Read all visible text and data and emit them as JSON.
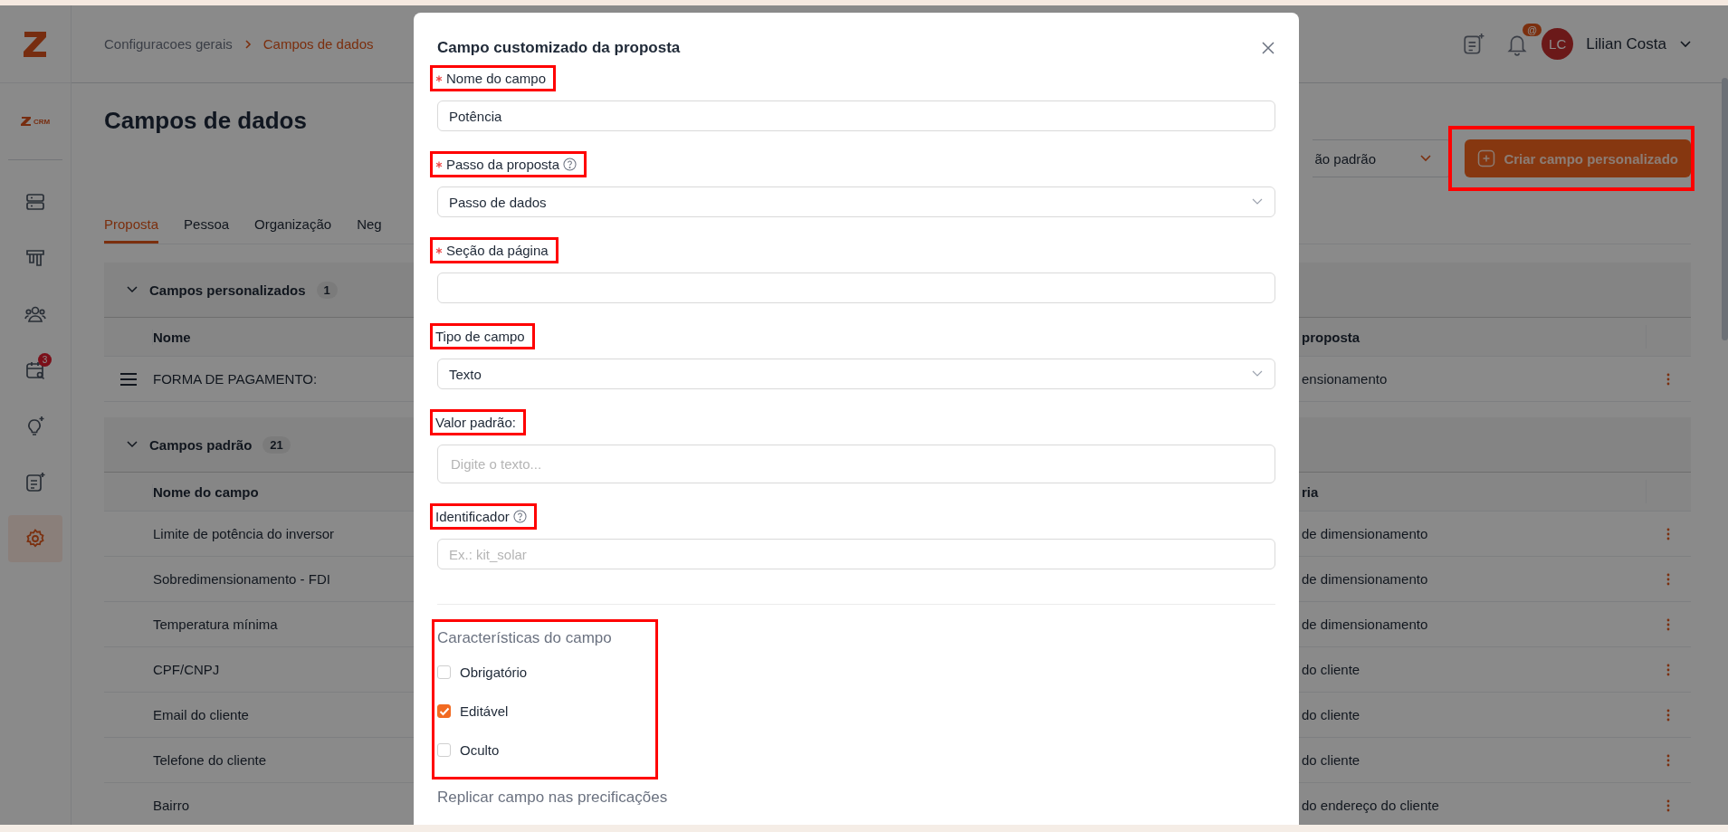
{
  "sidebar": {
    "brand": "CRM",
    "items": [
      {
        "kind": "servers",
        "selected": false
      },
      {
        "kind": "board",
        "selected": false
      },
      {
        "kind": "team",
        "selected": false
      },
      {
        "kind": "calendar",
        "selected": false,
        "badge": "3"
      },
      {
        "kind": "idea",
        "selected": false
      },
      {
        "kind": "notes",
        "selected": false
      },
      {
        "kind": "settings",
        "selected": true
      }
    ]
  },
  "breadcrumb": [
    {
      "label": "Configuracoes gerais",
      "current": false
    },
    {
      "label": "Campos de dados",
      "current": true
    }
  ],
  "header": {
    "notification_badge": "@",
    "user": {
      "initials": "LC",
      "name": "Lilian Costa"
    }
  },
  "page": {
    "title": "Campos de dados",
    "filter_value": "ão padrão",
    "create_button": {
      "label": "Criar campo personalizado",
      "highlighted": true
    },
    "tabs": [
      {
        "label": "Proposta",
        "selected": true
      },
      {
        "label": "Pessoa",
        "selected": false
      },
      {
        "label": "Organização",
        "selected": false
      },
      {
        "label": "Neg",
        "selected": false
      }
    ]
  },
  "sections": [
    {
      "title": "Campos personalizados",
      "count": "1",
      "expanded": true,
      "columns": [
        "Nome",
        "proposta"
      ],
      "rows": [
        {
          "name": "FORMA DE PAGAMENTO:",
          "column_2": "ensionamento",
          "draggable": true
        }
      ]
    },
    {
      "title": "Campos padrão",
      "count": "21",
      "expanded": true,
      "columns": [
        "Nome do campo",
        "ria"
      ],
      "rows": [
        {
          "name": "Limite de potência do inversor",
          "column_2": "de dimensionamento",
          "draggable": false
        },
        {
          "name": "Sobredimensionamento - FDI",
          "column_2": "de dimensionamento",
          "draggable": false
        },
        {
          "name": "Temperatura mínima",
          "column_2": "de dimensionamento",
          "draggable": false
        },
        {
          "name": "CPF/CNPJ",
          "column_2": "do cliente",
          "draggable": false
        },
        {
          "name": "Email do cliente",
          "column_2": "do cliente",
          "draggable": false
        },
        {
          "name": "Telefone do cliente",
          "column_2": "do cliente",
          "draggable": false
        },
        {
          "name": "Bairro",
          "column_2": "do endereço do cliente",
          "draggable": false
        }
      ]
    }
  ],
  "modal": {
    "title": "Campo customizado da proposta",
    "fields": [
      {
        "kind": "text",
        "label": "Nome do campo",
        "required": true,
        "help": false,
        "highlighted": true,
        "value": "Potência"
      },
      {
        "kind": "select",
        "label": "Passo da proposta",
        "required": true,
        "help": true,
        "highlighted": true,
        "value": "Passo de dados"
      },
      {
        "kind": "text",
        "label": "Seção da página",
        "required": true,
        "help": false,
        "highlighted": true
      },
      {
        "kind": "select",
        "label": "Tipo de campo",
        "required": false,
        "help": false,
        "highlighted": true,
        "value": "Texto"
      },
      {
        "kind": "textarea",
        "label": "Valor padrão:",
        "required": false,
        "help": false,
        "highlighted": true,
        "placeholder": "Digite o texto..."
      },
      {
        "kind": "text",
        "label": "Identificador",
        "required": false,
        "help": true,
        "highlighted": true,
        "placeholder": "Ex.: kit_solar"
      }
    ],
    "characteristics": {
      "title": "Características do campo",
      "highlighted": true,
      "options": [
        {
          "label": "Obrigatório",
          "checked": false
        },
        {
          "label": "Editável",
          "checked": true
        },
        {
          "label": "Oculto",
          "checked": false
        }
      ]
    },
    "replicate_title": "Replicar campo nas precificações"
  }
}
